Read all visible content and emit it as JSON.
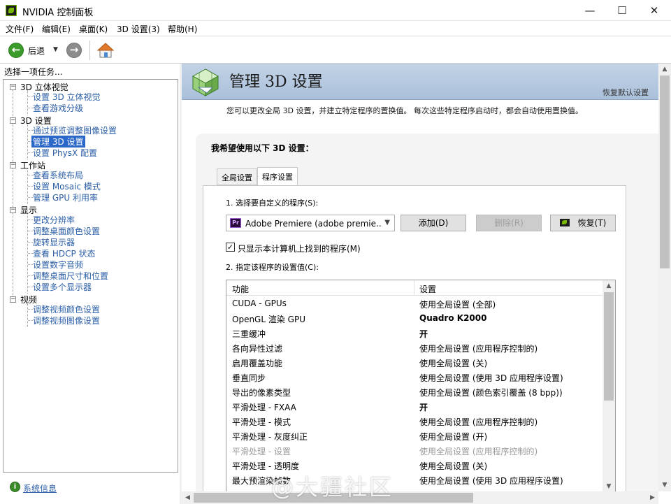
{
  "window": {
    "title": "NVIDIA 控制面板",
    "minimize": "—",
    "maximize": "☐",
    "close": "✕"
  },
  "menu": [
    "文件(F)",
    "编辑(E)",
    "桌面(K)",
    "3D 设置(3)",
    "帮助(H)"
  ],
  "toolbar": {
    "back_label": "后退"
  },
  "left_pane": {
    "header": "选择一项任务...",
    "tree": [
      {
        "label": "3D 立体视觉",
        "children": [
          "设置 3D 立体视觉",
          "查看游戏分级"
        ]
      },
      {
        "label": "3D 设置",
        "children": [
          "通过预览调整图像设置",
          "管理 3D 设置",
          "设置 PhysX 配置"
        ]
      },
      {
        "label": "工作站",
        "children": [
          "查看系统布局",
          "设置 Mosaic 模式",
          "管理 GPU 利用率"
        ]
      },
      {
        "label": "显示",
        "children": [
          "更改分辨率",
          "调整桌面颜色设置",
          "旋转显示器",
          "查看 HDCP 状态",
          "设置数字音频",
          "调整桌面尺寸和位置",
          "设置多个显示器"
        ]
      },
      {
        "label": "视频",
        "children": [
          "调整视频颜色设置",
          "调整视频图像设置"
        ]
      }
    ],
    "selected": "管理 3D 设置",
    "system_info_link": "系统信息"
  },
  "main": {
    "title": "管理 3D 设置",
    "restore_defaults": "恢复默认设置",
    "description": "您可以更改全局 3D 设置，并建立特定程序的置换值。 每次这些特定程序启动时，都会自动使用置换值。",
    "section_title": "我希望使用以下 3D 设置：",
    "tabs": [
      "全局设置",
      "程序设置"
    ],
    "active_tab": "程序设置",
    "step1_label": "1. 选择要自定义的程序(S):",
    "program_selected": "Adobe Premiere (adobe premie...",
    "add_button": "添加(D)",
    "remove_button": "删除(R)",
    "restore_button": "恢复(T)",
    "only_show_checkbox": {
      "label": "只显示本计算机上找到的程序(M)",
      "checked": "✓"
    },
    "step2_label": "2. 指定该程序的设置值(C):",
    "grid_headers": [
      "功能",
      "设置"
    ],
    "grid_rows": [
      {
        "feature": "CUDA - GPUs",
        "value": "使用全局设置 (全部)",
        "bold": false,
        "muted": false
      },
      {
        "feature": "OpenGL 渲染 GPU",
        "value": "Quadro K2000",
        "bold": true,
        "muted": false
      },
      {
        "feature": "三重缓冲",
        "value": "开",
        "bold": true,
        "muted": false
      },
      {
        "feature": "各向异性过滤",
        "value": "使用全局设置 (应用程序控制的)",
        "bold": false,
        "muted": false
      },
      {
        "feature": "启用覆盖功能",
        "value": "使用全局设置 (关)",
        "bold": false,
        "muted": false
      },
      {
        "feature": "垂直同步",
        "value": "使用全局设置 (使用 3D 应用程序设置)",
        "bold": false,
        "muted": false
      },
      {
        "feature": "导出的像素类型",
        "value": "使用全局设置 (颜色索引覆盖 (8 bpp))",
        "bold": false,
        "muted": false
      },
      {
        "feature": "平滑处理 - FXAA",
        "value": "开",
        "bold": true,
        "muted": false
      },
      {
        "feature": "平滑处理 - 模式",
        "value": "使用全局设置 (应用程序控制的)",
        "bold": false,
        "muted": false
      },
      {
        "feature": "平滑处理 - 灰度纠正",
        "value": "使用全局设置 (开)",
        "bold": false,
        "muted": false
      },
      {
        "feature": "平滑处理 - 设置",
        "value": "使用全局设置 (应用程序控制的)",
        "bold": false,
        "muted": true
      },
      {
        "feature": "平滑处理 - 透明度",
        "value": "使用全局设置 (关)",
        "bold": false,
        "muted": false
      },
      {
        "feature": "最大预渲染帧数",
        "value": "使用全局设置 (使用 3D 应用程序设置)",
        "bold": false,
        "muted": false
      }
    ]
  },
  "watermark": "@大疆社区",
  "colors": {
    "nvidia_green": "#76b900",
    "link_blue": "#2b5ea7",
    "selection": "#2a67c8",
    "banner": "#b7c9de"
  }
}
